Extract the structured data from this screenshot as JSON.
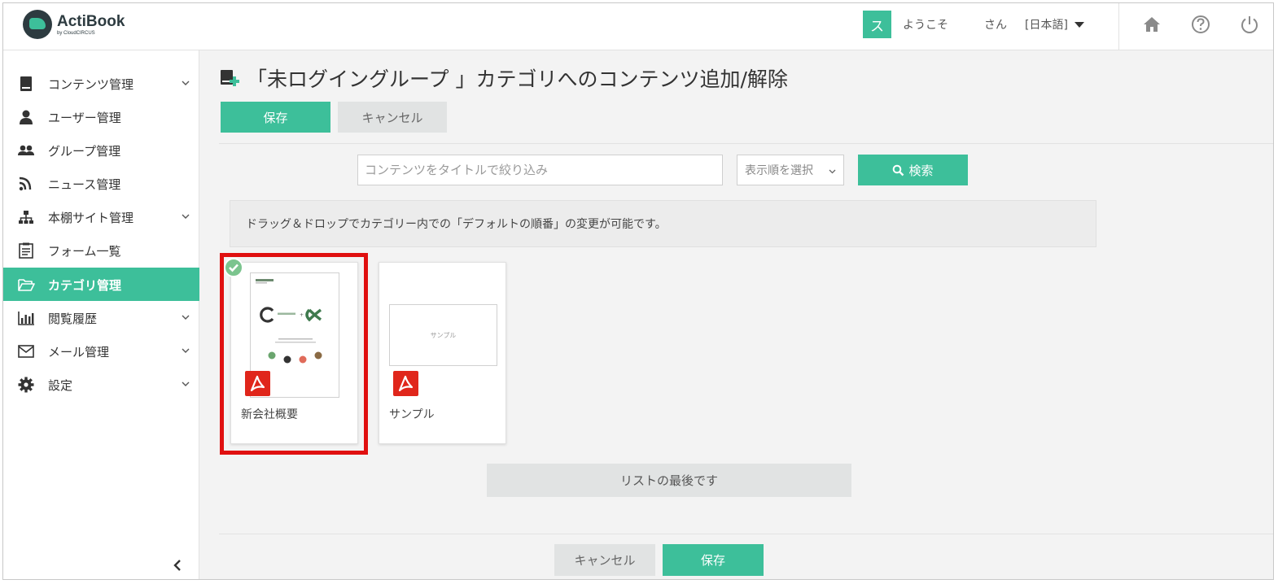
{
  "app": {
    "name": "ActiBook",
    "sub": "by CloudCIRCUS"
  },
  "header": {
    "avatar_initial": "ス",
    "welcome": "ようこそ",
    "san": "さん",
    "language": "[日本語]",
    "icons": [
      "home-icon",
      "help-icon",
      "power-icon"
    ]
  },
  "sidebar": {
    "items": [
      {
        "label": "コンテンツ管理",
        "icon": "book-icon",
        "has_chevron": true
      },
      {
        "label": "ユーザー管理",
        "icon": "user-icon",
        "has_chevron": false
      },
      {
        "label": "グループ管理",
        "icon": "group-icon",
        "has_chevron": false
      },
      {
        "label": "ニュース管理",
        "icon": "rss-icon",
        "has_chevron": false
      },
      {
        "label": "本棚サイト管理",
        "icon": "sitemap-icon",
        "has_chevron": true
      },
      {
        "label": "フォーム一覧",
        "icon": "form-icon",
        "has_chevron": false
      },
      {
        "label": "カテゴリ管理",
        "icon": "folder-icon",
        "has_chevron": false,
        "active": true
      },
      {
        "label": "閲覧履歴",
        "icon": "bar-chart-icon",
        "has_chevron": true
      },
      {
        "label": "メール管理",
        "icon": "mail-icon",
        "has_chevron": true
      },
      {
        "label": "設定",
        "icon": "gear-icon",
        "has_chevron": true
      }
    ]
  },
  "main": {
    "title": "「未ログイングループ 」カテゴリへのコンテンツ追加/解除",
    "save_label": "保存",
    "cancel_label": "キャンセル",
    "search": {
      "placeholder": "コンテンツをタイトルで絞り込み",
      "sort_label": "表示順を選択",
      "button_label": "検索"
    },
    "info": "ドラッグ＆ドロップでカテゴリー内での「デフォルトの順番」の変更が可能です。",
    "cards": [
      {
        "title": "新会社概要",
        "selected": true,
        "type": "pdf"
      },
      {
        "title": "サンプル",
        "selected": false,
        "type": "pdf",
        "thumb_text": "サンプル"
      }
    ],
    "end_of_list": "リストの最後です",
    "footer_cancel": "キャンセル",
    "footer_save": "保存"
  },
  "colors": {
    "accent": "#3dbf9a",
    "selection": "#e01010",
    "pdf": "#e0261b"
  }
}
